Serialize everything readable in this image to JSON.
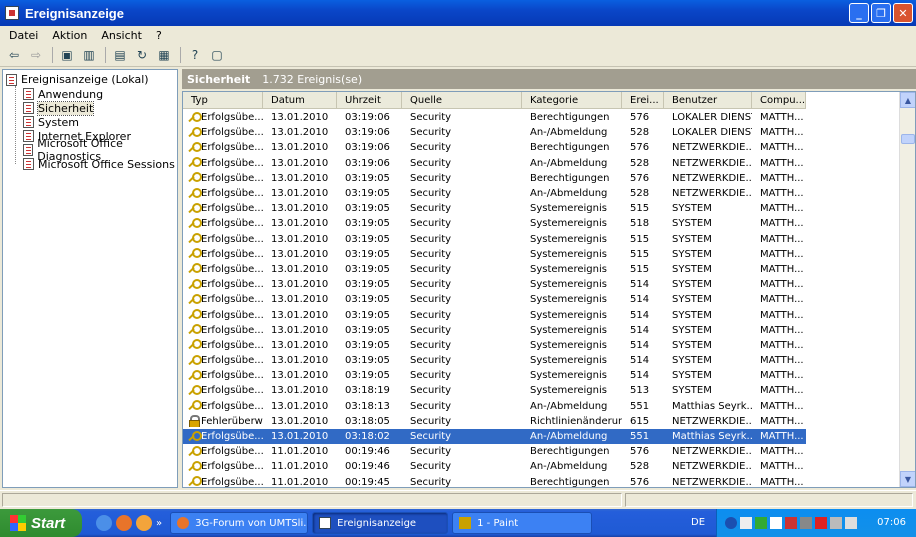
{
  "window": {
    "title": "Ereignisanzeige"
  },
  "menu": [
    "Datei",
    "Aktion",
    "Ansicht",
    "?"
  ],
  "tree": {
    "root": "Ereignisanzeige (Lokal)",
    "items": [
      "Anwendung",
      "Sicherheit",
      "System",
      "Internet Explorer",
      "Microsoft Office Diagnostics",
      "Microsoft Office Sessions"
    ],
    "selected": "Sicherheit"
  },
  "panel": {
    "title": "Sicherheit",
    "count": "1.732 Ereignis(se)"
  },
  "columns": [
    "Typ",
    "Datum",
    "Uhrzeit",
    "Quelle",
    "Kategorie",
    "Erei...",
    "Benutzer",
    "Compu..."
  ],
  "rows": [
    {
      "typ": "Erfolgsübe...",
      "datum": "13.01.2010",
      "uhrzeit": "03:19:06",
      "quelle": "Security",
      "kategorie": "Berechtigungen",
      "ereignis": "576",
      "benutzer": "LOKALER DIENST",
      "computer": "MATTH..."
    },
    {
      "typ": "Erfolgsübe...",
      "datum": "13.01.2010",
      "uhrzeit": "03:19:06",
      "quelle": "Security",
      "kategorie": "An-/Abmeldung",
      "ereignis": "528",
      "benutzer": "LOKALER DIENST",
      "computer": "MATTH..."
    },
    {
      "typ": "Erfolgsübe...",
      "datum": "13.01.2010",
      "uhrzeit": "03:19:06",
      "quelle": "Security",
      "kategorie": "Berechtigungen",
      "ereignis": "576",
      "benutzer": "NETZWERKDIE...",
      "computer": "MATTH..."
    },
    {
      "typ": "Erfolgsübe...",
      "datum": "13.01.2010",
      "uhrzeit": "03:19:06",
      "quelle": "Security",
      "kategorie": "An-/Abmeldung",
      "ereignis": "528",
      "benutzer": "NETZWERKDIE...",
      "computer": "MATTH..."
    },
    {
      "typ": "Erfolgsübe...",
      "datum": "13.01.2010",
      "uhrzeit": "03:19:05",
      "quelle": "Security",
      "kategorie": "Berechtigungen",
      "ereignis": "576",
      "benutzer": "NETZWERKDIE...",
      "computer": "MATTH..."
    },
    {
      "typ": "Erfolgsübe...",
      "datum": "13.01.2010",
      "uhrzeit": "03:19:05",
      "quelle": "Security",
      "kategorie": "An-/Abmeldung",
      "ereignis": "528",
      "benutzer": "NETZWERKDIE...",
      "computer": "MATTH..."
    },
    {
      "typ": "Erfolgsübe...",
      "datum": "13.01.2010",
      "uhrzeit": "03:19:05",
      "quelle": "Security",
      "kategorie": "Systemereignis",
      "ereignis": "515",
      "benutzer": "SYSTEM",
      "computer": "MATTH..."
    },
    {
      "typ": "Erfolgsübe...",
      "datum": "13.01.2010",
      "uhrzeit": "03:19:05",
      "quelle": "Security",
      "kategorie": "Systemereignis",
      "ereignis": "518",
      "benutzer": "SYSTEM",
      "computer": "MATTH..."
    },
    {
      "typ": "Erfolgsübe...",
      "datum": "13.01.2010",
      "uhrzeit": "03:19:05",
      "quelle": "Security",
      "kategorie": "Systemereignis",
      "ereignis": "515",
      "benutzer": "SYSTEM",
      "computer": "MATTH..."
    },
    {
      "typ": "Erfolgsübe...",
      "datum": "13.01.2010",
      "uhrzeit": "03:19:05",
      "quelle": "Security",
      "kategorie": "Systemereignis",
      "ereignis": "515",
      "benutzer": "SYSTEM",
      "computer": "MATTH..."
    },
    {
      "typ": "Erfolgsübe...",
      "datum": "13.01.2010",
      "uhrzeit": "03:19:05",
      "quelle": "Security",
      "kategorie": "Systemereignis",
      "ereignis": "515",
      "benutzer": "SYSTEM",
      "computer": "MATTH..."
    },
    {
      "typ": "Erfolgsübe...",
      "datum": "13.01.2010",
      "uhrzeit": "03:19:05",
      "quelle": "Security",
      "kategorie": "Systemereignis",
      "ereignis": "514",
      "benutzer": "SYSTEM",
      "computer": "MATTH..."
    },
    {
      "typ": "Erfolgsübe...",
      "datum": "13.01.2010",
      "uhrzeit": "03:19:05",
      "quelle": "Security",
      "kategorie": "Systemereignis",
      "ereignis": "514",
      "benutzer": "SYSTEM",
      "computer": "MATTH..."
    },
    {
      "typ": "Erfolgsübe...",
      "datum": "13.01.2010",
      "uhrzeit": "03:19:05",
      "quelle": "Security",
      "kategorie": "Systemereignis",
      "ereignis": "514",
      "benutzer": "SYSTEM",
      "computer": "MATTH..."
    },
    {
      "typ": "Erfolgsübe...",
      "datum": "13.01.2010",
      "uhrzeit": "03:19:05",
      "quelle": "Security",
      "kategorie": "Systemereignis",
      "ereignis": "514",
      "benutzer": "SYSTEM",
      "computer": "MATTH..."
    },
    {
      "typ": "Erfolgsübe...",
      "datum": "13.01.2010",
      "uhrzeit": "03:19:05",
      "quelle": "Security",
      "kategorie": "Systemereignis",
      "ereignis": "514",
      "benutzer": "SYSTEM",
      "computer": "MATTH..."
    },
    {
      "typ": "Erfolgsübe...",
      "datum": "13.01.2010",
      "uhrzeit": "03:19:05",
      "quelle": "Security",
      "kategorie": "Systemereignis",
      "ereignis": "514",
      "benutzer": "SYSTEM",
      "computer": "MATTH..."
    },
    {
      "typ": "Erfolgsübe...",
      "datum": "13.01.2010",
      "uhrzeit": "03:19:05",
      "quelle": "Security",
      "kategorie": "Systemereignis",
      "ereignis": "514",
      "benutzer": "SYSTEM",
      "computer": "MATTH..."
    },
    {
      "typ": "Erfolgsübe...",
      "datum": "13.01.2010",
      "uhrzeit": "03:18:19",
      "quelle": "Security",
      "kategorie": "Systemereignis",
      "ereignis": "513",
      "benutzer": "SYSTEM",
      "computer": "MATTH..."
    },
    {
      "typ": "Erfolgsübe...",
      "datum": "13.01.2010",
      "uhrzeit": "03:18:13",
      "quelle": "Security",
      "kategorie": "An-/Abmeldung",
      "ereignis": "551",
      "benutzer": "Matthias Seyrk...",
      "computer": "MATTH..."
    },
    {
      "typ": "Fehlerüberw...",
      "datum": "13.01.2010",
      "uhrzeit": "03:18:05",
      "quelle": "Security",
      "kategorie": "Richtlinienänderung",
      "ereignis": "615",
      "benutzer": "NETZWERKDIE...",
      "computer": "MATTH...",
      "icon": "lock"
    },
    {
      "typ": "Erfolgsübe...",
      "datum": "13.01.2010",
      "uhrzeit": "03:18:02",
      "quelle": "Security",
      "kategorie": "An-/Abmeldung",
      "ereignis": "551",
      "benutzer": "Matthias Seyrk...",
      "computer": "MATTH...",
      "selected": true
    },
    {
      "typ": "Erfolgsübe...",
      "datum": "11.01.2010",
      "uhrzeit": "00:19:46",
      "quelle": "Security",
      "kategorie": "Berechtigungen",
      "ereignis": "576",
      "benutzer": "NETZWERKDIE...",
      "computer": "MATTH..."
    },
    {
      "typ": "Erfolgsübe...",
      "datum": "11.01.2010",
      "uhrzeit": "00:19:46",
      "quelle": "Security",
      "kategorie": "An-/Abmeldung",
      "ereignis": "528",
      "benutzer": "NETZWERKDIE...",
      "computer": "MATTH..."
    },
    {
      "typ": "Erfolgsübe...",
      "datum": "11.01.2010",
      "uhrzeit": "00:19:45",
      "quelle": "Security",
      "kategorie": "Berechtigungen",
      "ereignis": "576",
      "benutzer": "NETZWERKDIE...",
      "computer": "MATTH..."
    }
  ],
  "taskbar": {
    "start": "Start",
    "tasks": [
      "3G-Forum von UMTSli...",
      "Ereignisanzeige",
      "1 - Paint"
    ],
    "lang": "DE",
    "clock": "07:06"
  },
  "colors": {
    "selection": "#316ac5",
    "titlebar": "#0a46c8",
    "taskbar": "#245edb",
    "start": "#2f8b2f"
  }
}
